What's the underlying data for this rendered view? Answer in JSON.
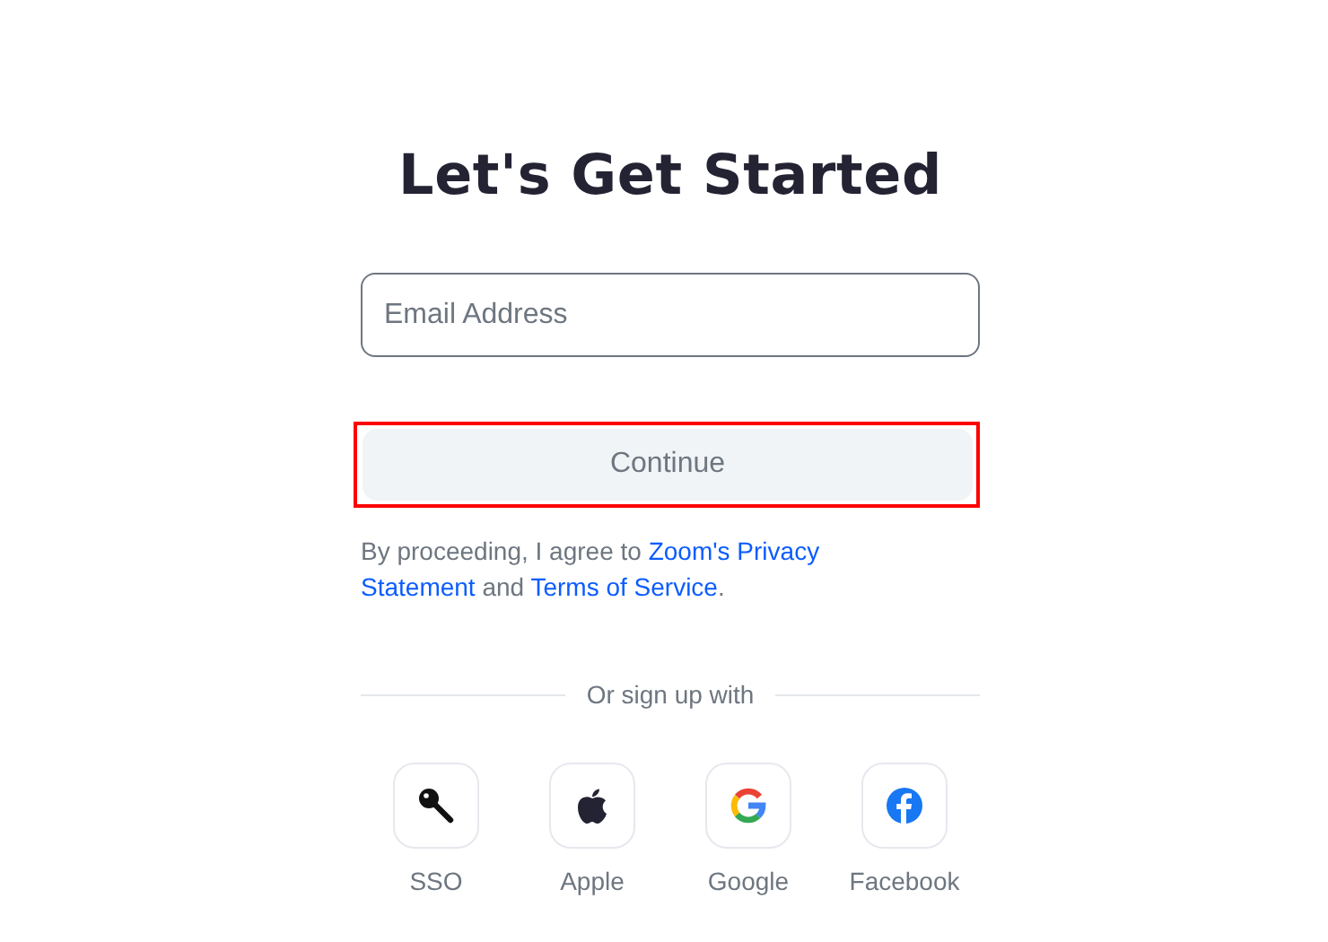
{
  "title": "Let's Get Started",
  "email_field": {
    "placeholder": "Email Address"
  },
  "continue_button": {
    "label": "Continue",
    "disabled": true,
    "highlighted": true
  },
  "terms": {
    "before": "By proceeding, I agree to ",
    "link1": "Zoom's Privacy Statement",
    "middle": " and ",
    "link2": "Terms of Service",
    "after": "."
  },
  "divider_label": "Or sign up with",
  "providers": [
    {
      "kind": "sso",
      "label": "SSO"
    },
    {
      "kind": "apple",
      "label": "Apple"
    },
    {
      "kind": "google",
      "label": "Google"
    },
    {
      "kind": "facebook",
      "label": "Facebook"
    }
  ]
}
